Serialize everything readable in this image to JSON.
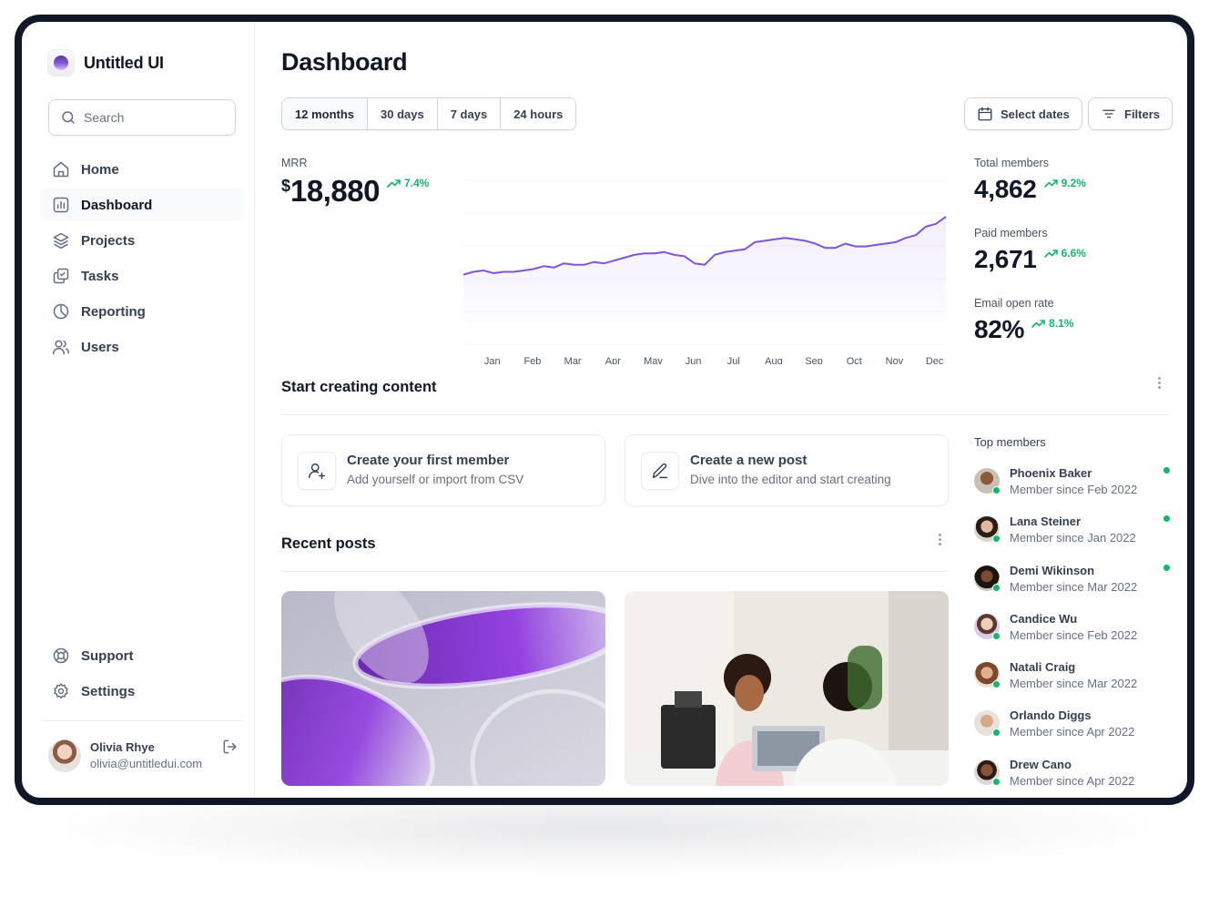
{
  "brand": {
    "name": "Untitled UI"
  },
  "search": {
    "placeholder": "Search"
  },
  "nav": {
    "items": [
      {
        "label": "Home",
        "icon": "home-icon"
      },
      {
        "label": "Dashboard",
        "icon": "bar-chart-icon",
        "active": true
      },
      {
        "label": "Projects",
        "icon": "layers-icon"
      },
      {
        "label": "Tasks",
        "icon": "check-square-icon"
      },
      {
        "label": "Reporting",
        "icon": "pie-chart-icon"
      },
      {
        "label": "Users",
        "icon": "users-icon"
      }
    ],
    "bottom": [
      {
        "label": "Support",
        "icon": "life-buoy-icon"
      },
      {
        "label": "Settings",
        "icon": "gear-icon"
      }
    ]
  },
  "user": {
    "name": "Olivia Rhye",
    "email": "olivia@untitledui.com"
  },
  "page": {
    "title": "Dashboard"
  },
  "range_tabs": [
    "12 months",
    "30 days",
    "7 days",
    "24 hours"
  ],
  "range_active": "12 months",
  "actions": {
    "select_dates": "Select dates",
    "filters": "Filters"
  },
  "mrr": {
    "label": "MRR",
    "currency": "$",
    "value": "18,880",
    "delta": "7.4%"
  },
  "stats": [
    {
      "label": "Total members",
      "value": "4,862",
      "delta": "9.2%"
    },
    {
      "label": "Paid members",
      "value": "2,671",
      "delta": "6.6%"
    },
    {
      "label": "Email open rate",
      "value": "82%",
      "delta": "8.1%"
    }
  ],
  "chart_data": {
    "type": "area",
    "categories": [
      "Jan",
      "Feb",
      "Mar",
      "Apr",
      "May",
      "Jun",
      "Jul",
      "Aug",
      "Sep",
      "Oct",
      "Nov",
      "Dec"
    ],
    "x": [
      0,
      0.25,
      0.5,
      0.75,
      1,
      1.25,
      1.5,
      1.75,
      2,
      2.25,
      2.5,
      2.75,
      3,
      3.25,
      3.5,
      3.75,
      4,
      4.25,
      4.5,
      4.75,
      5,
      5.25,
      5.5,
      5.75,
      6,
      6.25,
      6.5,
      6.75,
      7,
      7.25,
      7.5,
      7.75,
      8,
      8.25,
      8.5,
      8.75,
      9,
      9.25,
      9.5,
      9.75,
      10,
      10.25,
      10.5,
      10.75,
      11,
      11.25,
      11.5,
      11.75,
      12
    ],
    "values": [
      54,
      55,
      55.5,
      54.5,
      55,
      55,
      55.5,
      56,
      57,
      56.5,
      58,
      57.5,
      57.5,
      58.5,
      58,
      59,
      60,
      61,
      61.5,
      61.5,
      62,
      61,
      60.5,
      58,
      57.5,
      61,
      62,
      62.5,
      63,
      65.5,
      66,
      66.5,
      67,
      66.5,
      66,
      65,
      63.5,
      63.5,
      65,
      64,
      64,
      64.5,
      65,
      65.5,
      67,
      68,
      71,
      72,
      74.5
    ],
    "ylim": [
      0,
      100
    ],
    "color": "#7f56d9",
    "grid": true
  },
  "content": {
    "title": "Start creating content",
    "cards": [
      {
        "title": "Create your first member",
        "subtitle": "Add yourself or import from CSV",
        "icon": "user-plus-icon"
      },
      {
        "title": "Create a new post",
        "subtitle": "Dive into the editor and start creating",
        "icon": "pen-icon"
      }
    ]
  },
  "recent_posts": {
    "title": "Recent posts"
  },
  "top_members": {
    "title": "Top members",
    "items": [
      {
        "name": "Phoenix Baker",
        "since": "Member since Feb 2022",
        "active": true
      },
      {
        "name": "Lana Steiner",
        "since": "Member since Jan 2022",
        "active": true
      },
      {
        "name": "Demi Wikinson",
        "since": "Member since Mar 2022",
        "active": true
      },
      {
        "name": "Candice Wu",
        "since": "Member since Feb 2022",
        "active": false
      },
      {
        "name": "Natali Craig",
        "since": "Member since Mar 2022",
        "active": false
      },
      {
        "name": "Orlando Diggs",
        "since": "Member since Apr 2022",
        "active": false
      },
      {
        "name": "Drew Cano",
        "since": "Member since Apr 2022",
        "active": false
      }
    ]
  },
  "colors": {
    "accent": "#7f56d9",
    "success": "#12b76a",
    "text": "#101828",
    "border": "#eaecf0"
  }
}
